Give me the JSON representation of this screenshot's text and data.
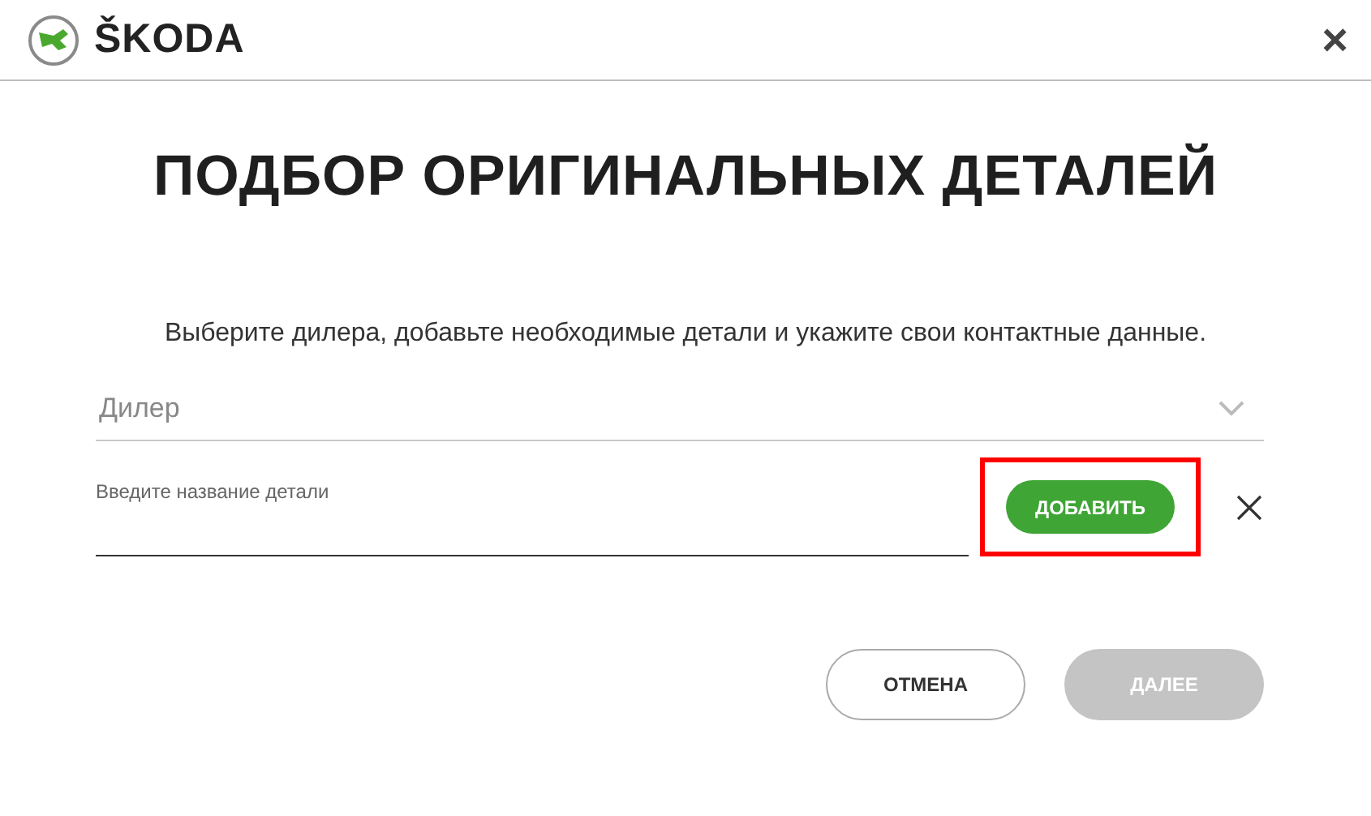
{
  "header": {
    "brand": "ŠKODA",
    "close": "×"
  },
  "title": "ПОДБОР ОРИГИНАЛЬНЫХ ДЕТАЛЕЙ",
  "intro": "Выберите дилера, добавьте необходимые детали и укажите свои контактные данные.",
  "dealer": {
    "placeholder": "Дилер"
  },
  "part": {
    "label": "Введите название детали",
    "add": "ДОБАВИТЬ",
    "highlighted": true
  },
  "buttons": [
    {
      "label": "ОТМЕНА",
      "kind": "outline",
      "disabled": false
    },
    {
      "label": "ДАЛЕЕ",
      "kind": "filled",
      "disabled": true
    }
  ]
}
